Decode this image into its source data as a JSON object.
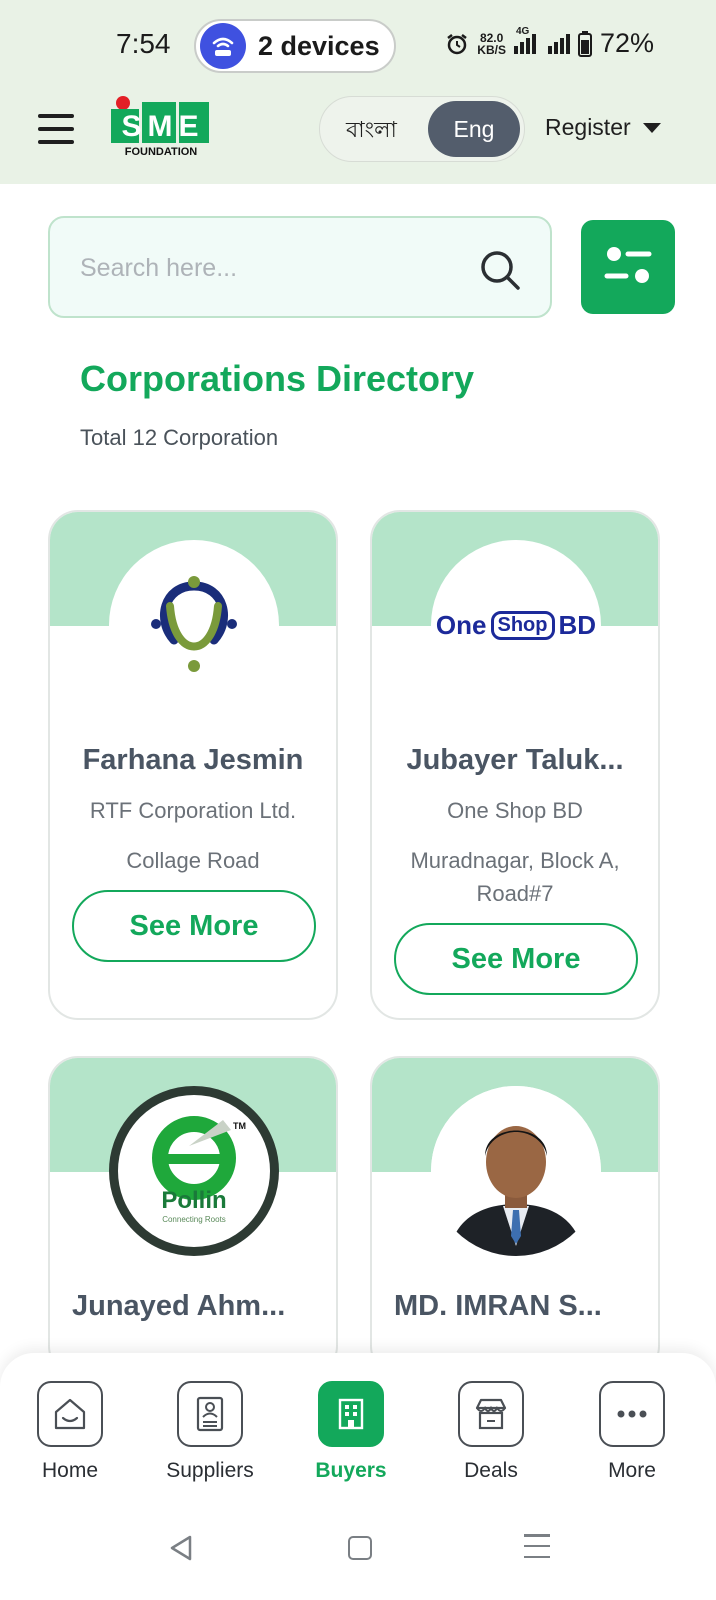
{
  "status_bar": {
    "time": "7:54",
    "devices": "2 devices",
    "speed_value": "82.0",
    "speed_unit": "KB/S",
    "network": "4G",
    "battery": "72%"
  },
  "header": {
    "logo_text": "SME",
    "logo_sub": "FOUNDATION",
    "lang_bn": "বাংলা",
    "lang_en": "Eng",
    "register_label": "Register"
  },
  "search": {
    "placeholder": "Search here...",
    "value": ""
  },
  "directory": {
    "title": "Corporations Directory",
    "count": "Total 12 Corporation"
  },
  "cards": [
    {
      "name": "Farhana Jesmin",
      "company": "RTF Corporation Ltd.",
      "address": "Collage Road",
      "button": "See More",
      "logo": "rtf-logo"
    },
    {
      "name": "Jubayer Taluk...",
      "company": "One Shop BD",
      "address": "Muradnagar, Block A, Road#7",
      "button": "See More",
      "logo": "oneshop-logo",
      "logo_text_left": "One",
      "logo_text_mid": "Shop",
      "logo_text_right": "BD"
    },
    {
      "name": "Junayed  Ahm...",
      "logo": "epollin-logo",
      "logo_text": "Pollin",
      "logo_sub": "Connecting Roots",
      "logo_tm": "TM"
    },
    {
      "name": "MD. IMRAN S...",
      "logo": "profile-photo"
    }
  ],
  "bottom_nav": [
    {
      "label": "Home",
      "icon": "home-icon",
      "active": false
    },
    {
      "label": "Suppliers",
      "icon": "suppliers-icon",
      "active": false
    },
    {
      "label": "Buyers",
      "icon": "buyers-icon",
      "active": true
    },
    {
      "label": "Deals",
      "icon": "deals-icon",
      "active": false
    },
    {
      "label": "More",
      "icon": "more-icon",
      "active": false
    }
  ],
  "colors": {
    "brand_green": "#13a85b",
    "band_green": "#b4e4c9",
    "header_bg": "#e9f2e6",
    "lang_active": "#535d6c"
  }
}
